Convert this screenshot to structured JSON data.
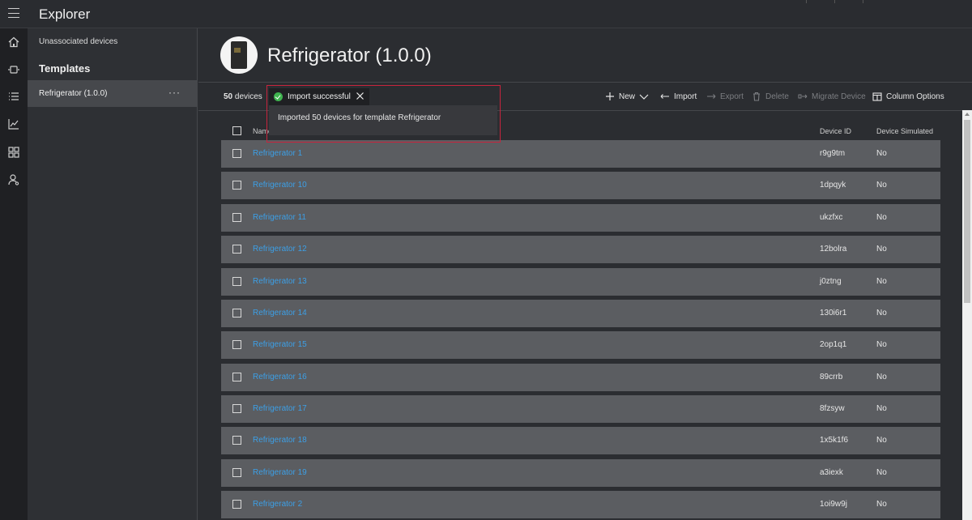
{
  "app": {
    "title": "Explorer"
  },
  "sidebar": {
    "unassociated_label": "Unassociated devices",
    "templates_heading": "Templates",
    "items": [
      {
        "label": "Refrigerator (1.0.0)",
        "more": "···"
      }
    ]
  },
  "device": {
    "title": "Refrigerator (1.0.0)"
  },
  "toolbar": {
    "count_number": "50",
    "count_suffix": " devices",
    "new_label": "New",
    "import_label": "Import",
    "export_label": "Export",
    "delete_label": "Delete",
    "migrate_label": "Migrate Device",
    "column_options_label": "Column Options"
  },
  "table": {
    "headers": {
      "name": "Name",
      "device_id": "Device ID",
      "simulated": "Device Simulated"
    },
    "rows": [
      {
        "name": "Refrigerator 1",
        "device_id": "r9g9tm",
        "simulated": "No"
      },
      {
        "name": "Refrigerator 10",
        "device_id": "1dpqyk",
        "simulated": "No"
      },
      {
        "name": "Refrigerator 11",
        "device_id": "ukzfxc",
        "simulated": "No"
      },
      {
        "name": "Refrigerator 12",
        "device_id": "12bolra",
        "simulated": "No"
      },
      {
        "name": "Refrigerator 13",
        "device_id": "j0ztng",
        "simulated": "No"
      },
      {
        "name": "Refrigerator 14",
        "device_id": "130i6r1",
        "simulated": "No"
      },
      {
        "name": "Refrigerator 15",
        "device_id": "2op1q1",
        "simulated": "No"
      },
      {
        "name": "Refrigerator 16",
        "device_id": "89crrb",
        "simulated": "No"
      },
      {
        "name": "Refrigerator 17",
        "device_id": "8fzsyw",
        "simulated": "No"
      },
      {
        "name": "Refrigerator 18",
        "device_id": "1x5k1f6",
        "simulated": "No"
      },
      {
        "name": "Refrigerator 19",
        "device_id": "a3iexk",
        "simulated": "No"
      },
      {
        "name": "Refrigerator 2",
        "device_id": "1oi9w9j",
        "simulated": "No"
      }
    ]
  },
  "toast": {
    "title": "Import successful",
    "message": "Imported 50 devices for template Refrigerator",
    "status_color": "#3fb34f",
    "highlight_color": "#c8243d"
  },
  "colors": {
    "link": "#3c9fe6",
    "row_bg": "#5b5d61",
    "panel_bg": "#2e3034"
  },
  "icons": [
    "hamburger-icon",
    "home-icon",
    "devices-icon",
    "rules-icon",
    "analytics-icon",
    "dashboard-icon",
    "administration-icon",
    "plus-icon",
    "chevron-down-icon",
    "import-icon",
    "export-icon",
    "delete-icon",
    "migrate-icon",
    "column-options-icon",
    "success-icon",
    "close-icon"
  ]
}
